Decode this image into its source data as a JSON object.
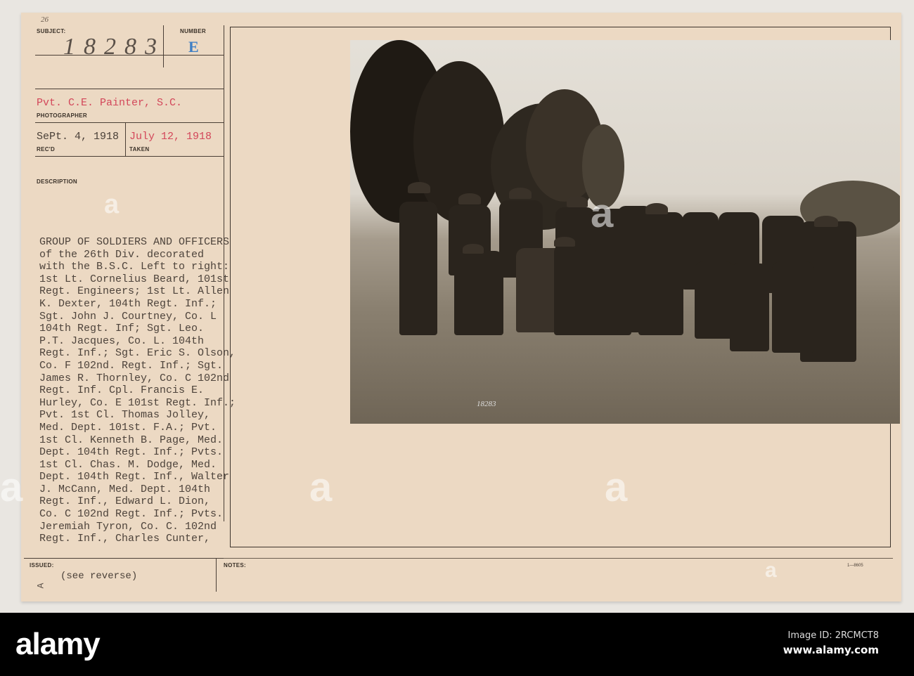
{
  "card": {
    "corner_note": "26",
    "subject_label": "SUBJECT:",
    "subject_value": "18283",
    "number_label": "NUMBER",
    "number_value": "E",
    "photographer_value": "Pvt. C.E. Painter, S.C.",
    "photographer_label": "PHOTOGRAPHER",
    "received_value": "SePt. 4, 1918",
    "received_label": "REC'D",
    "taken_value": "July 12, 1918",
    "taken_label": "TAKEN",
    "description_label": "DESCRIPTION",
    "description_lines": [
      "GROUP OF SOLDIERS AND OFFICERS",
      "of the 26th Div. decorated",
      "with the B.S.C. Left to right:",
      "1st Lt. Cornelius Beard, 101st",
      "Regt. Engineers; 1st Lt. Allen",
      "K. Dexter, 104th Regt. Inf.;",
      "Sgt. John J. Courtney, Co. L",
      "104th Regt. Inf; Sgt. Leo.",
      "P.T. Jacques, Co. L. 104th",
      "Regt. Inf.; Sgt. Eric S. Olson,",
      "Co. F 102nd. Regt. Inf.; Sgt.",
      "James R. Thornley, Co. C 102nd",
      "Regt. Inf. Cpl. Francis E.",
      "Hurley, Co. E 101st Regt. Inf.;",
      "Pvt. 1st Cl. Thomas Jolley,",
      "Med. Dept. 101st. F.A.; Pvt.",
      "1st Cl. Kenneth B. Page, Med.",
      "Dept. 104th Regt. Inf.; Pvts.",
      "1st Cl. Chas. M. Dodge, Med.",
      "Dept. 104th Regt. Inf., Walter",
      "J. McCann, Med. Dept. 104th",
      "Regt. Inf., Edward L. Dion,",
      "Co. C 102nd Regt. Inf.; Pvts.",
      "Jeremiah Tyron, Co. C. 102nd",
      "Regt. Inf., Charles Cunter,"
    ],
    "issued_label": "ISSUED:",
    "issued_mark": "A",
    "see_reverse": "(see reverse)",
    "notes_label": "NOTES:",
    "form_number": "1—8605",
    "photo_number": "18283"
  },
  "watermark": "a",
  "footer": {
    "logo": "alamy",
    "image_id": "Image ID: 2RCMCT8",
    "site": "www.alamy.com"
  }
}
